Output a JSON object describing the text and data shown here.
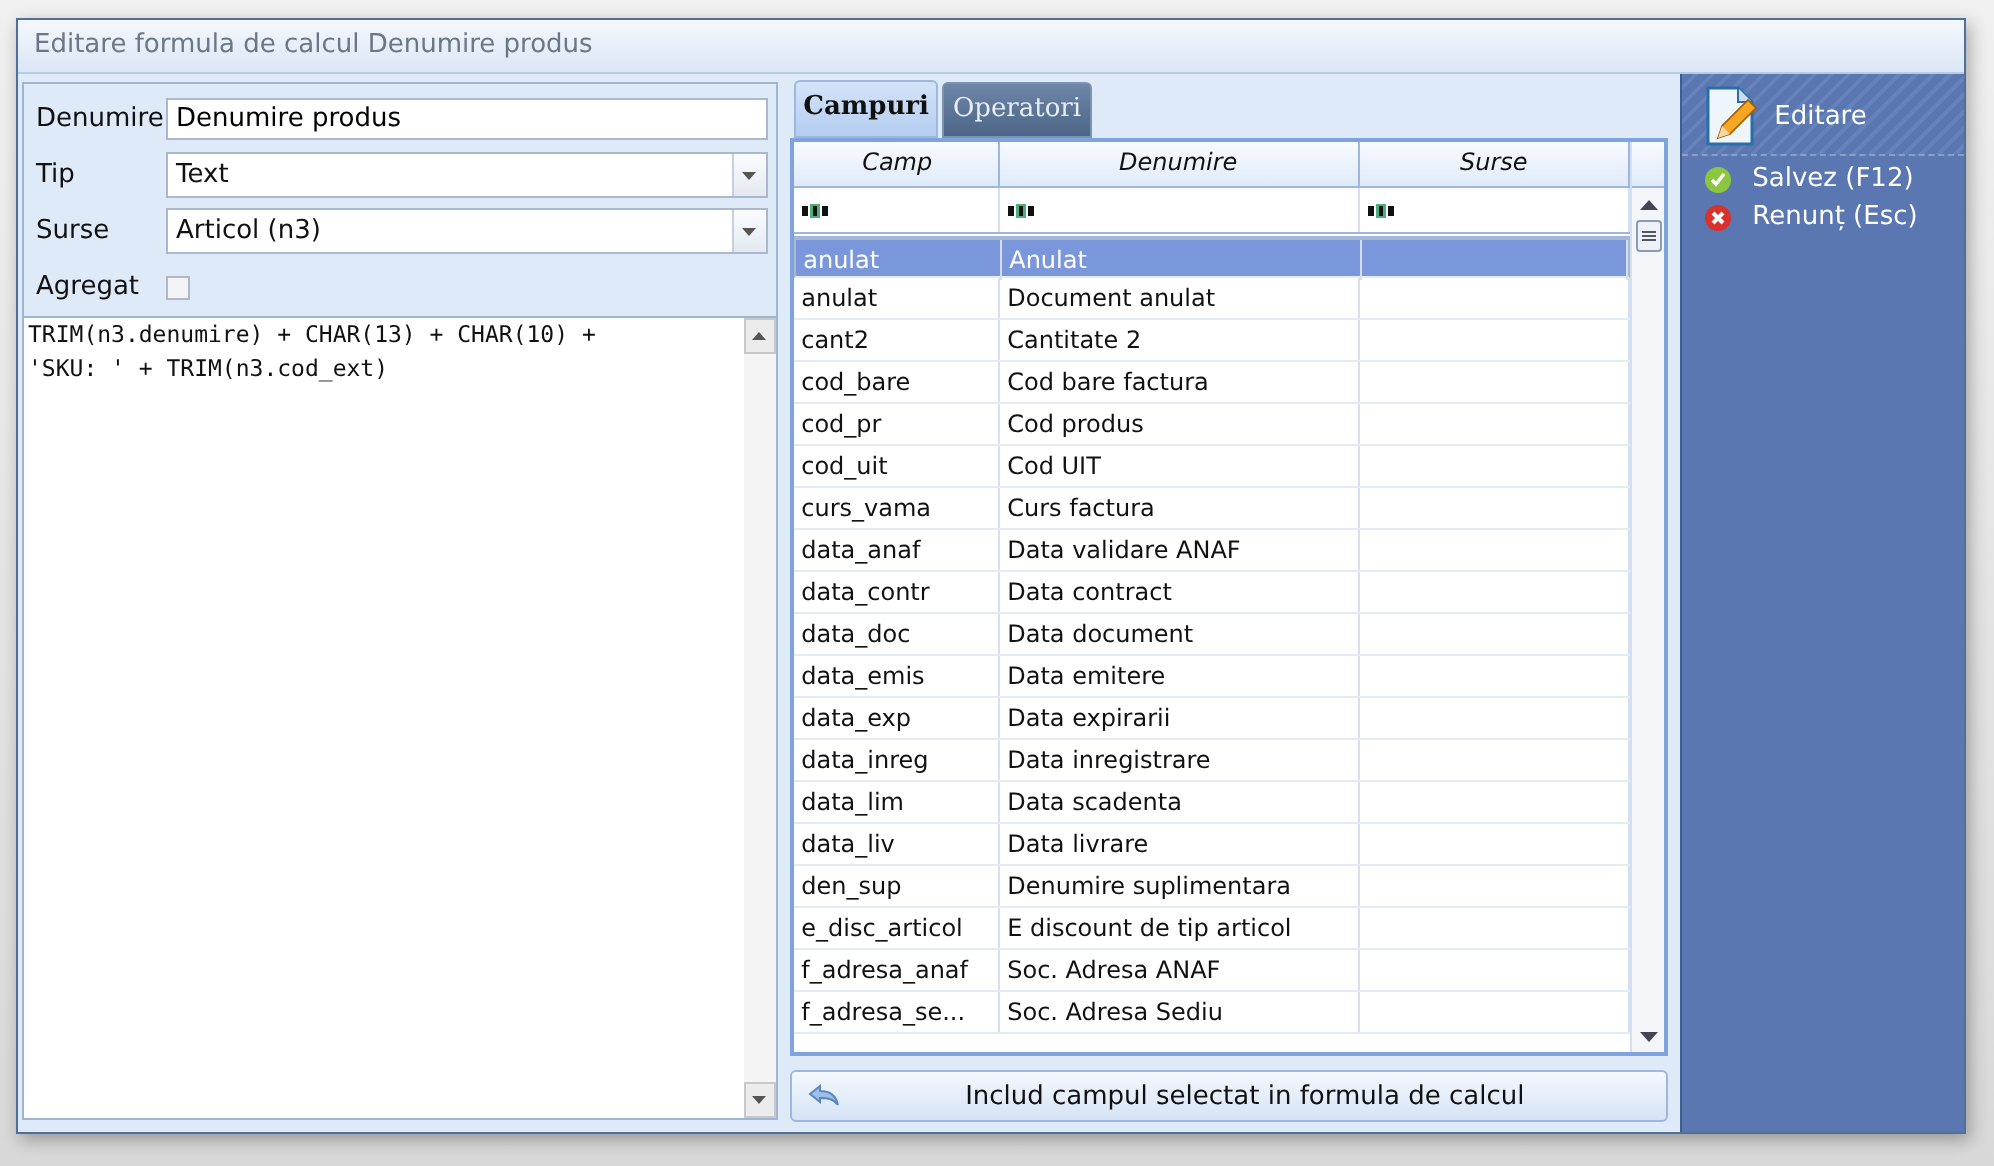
{
  "window": {
    "title": "Editare formula de calcul Denumire produs"
  },
  "form": {
    "fields": [
      {
        "kind": "text",
        "label": "Denumire",
        "value": "Denumire produs"
      },
      {
        "kind": "select",
        "label": "Tip",
        "value": "Text"
      },
      {
        "kind": "select",
        "label": "Surse",
        "value": "Articol (n3)"
      },
      {
        "kind": "checkbox",
        "label": "Agregat",
        "checked": false
      }
    ]
  },
  "formula": {
    "value": "TRIM(n3.denumire) + CHAR(13) + CHAR(10) +\n'SKU: ' + TRIM(n3.cod_ext)"
  },
  "tabs": [
    {
      "label": "Campuri",
      "selected": true
    },
    {
      "label": "Operatori",
      "selected": false
    }
  ],
  "table": {
    "columns": [
      "Camp",
      "Denumire",
      "Surse"
    ],
    "rows": [
      {
        "camp": "anulat",
        "denumire": "Anulat",
        "selected": true
      },
      {
        "camp": "anulat",
        "denumire": "Document anulat",
        "selected": false
      },
      {
        "camp": "cant2",
        "denumire": "Cantitate 2",
        "selected": false
      },
      {
        "camp": "cod_bare",
        "denumire": "Cod bare factura",
        "selected": false
      },
      {
        "camp": "cod_pr",
        "denumire": "Cod produs",
        "selected": false
      },
      {
        "camp": "cod_uit",
        "denumire": "Cod UIT",
        "selected": false
      },
      {
        "camp": "curs_vama",
        "denumire": "Curs factura",
        "selected": false
      },
      {
        "camp": "data_anaf",
        "denumire": "Data validare ANAF",
        "selected": false
      },
      {
        "camp": "data_contr",
        "denumire": "Data contract",
        "selected": false
      },
      {
        "camp": "data_doc",
        "denumire": "Data document",
        "selected": false
      },
      {
        "camp": "data_emis",
        "denumire": "Data emitere",
        "selected": false
      },
      {
        "camp": "data_exp",
        "denumire": "Data expirarii",
        "selected": false
      },
      {
        "camp": "data_inreg",
        "denumire": "Data inregistrare",
        "selected": false
      },
      {
        "camp": "data_lim",
        "denumire": "Data scadenta",
        "selected": false
      },
      {
        "camp": "data_liv",
        "denumire": "Data livrare",
        "selected": false
      },
      {
        "camp": "den_sup",
        "denumire": "Denumire suplimentara",
        "selected": false
      },
      {
        "camp": "e_disc_articol",
        "denumire": "E discount de tip articol",
        "selected": false
      },
      {
        "camp": "f_adresa_anaf",
        "denumire": "Soc. Adresa ANAF",
        "selected": false
      },
      {
        "camp": "f_adresa_se...",
        "denumire": "Soc. Adresa Sediu",
        "selected": false
      }
    ]
  },
  "include_button": {
    "label": "Includ campul selectat in formula de calcul"
  },
  "sidebar": {
    "title": "Editare",
    "actions": [
      {
        "kind": "save",
        "label": "Salvez (F12)"
      },
      {
        "kind": "cancel",
        "label": "Renunț (Esc)"
      }
    ]
  }
}
